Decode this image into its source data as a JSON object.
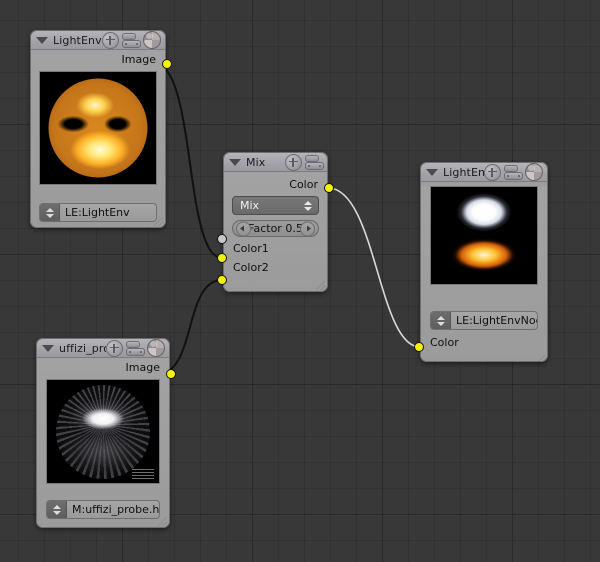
{
  "editor": {
    "name": "node-editor-canvas",
    "background_color": "#383838",
    "grid_color": "#2e2e2e"
  },
  "colors": {
    "socket_color": "#f2f20a",
    "socket_value": "#c8c8c8",
    "node_header": "#a3a3a9",
    "node_body": "#9b9b9b",
    "link_unselected": "#111111",
    "link_selected": "#d8d8d8"
  },
  "nodes": [
    {
      "id": "lightenv-source",
      "title": "LightEnv",
      "header_icons": [
        "plus-icon",
        "toggle-icon",
        "sphere-preview-icon"
      ],
      "outputs": [
        {
          "label": "Image",
          "type": "color"
        }
      ],
      "inputs": [],
      "field": {
        "label": "LE:LightEnv",
        "widget": "stepper-text"
      },
      "preview": "orange-light-probe"
    },
    {
      "id": "mix",
      "title": "Mix",
      "header_icons": [
        "plus-icon",
        "toggle-icon"
      ],
      "outputs": [
        {
          "label": "Color",
          "type": "color"
        }
      ],
      "dropdown": {
        "value": "Mix"
      },
      "slider": {
        "label": "Factor 0.5",
        "name": "Factor",
        "value": "0.5"
      },
      "inputs": [
        {
          "label": "Color1",
          "type": "color"
        },
        {
          "label": "Color2",
          "type": "color"
        }
      ]
    },
    {
      "id": "uffizi-probe",
      "title": "uffizi_pro",
      "header_icons": [
        "plus-icon",
        "toggle-icon",
        "sphere-preview-icon"
      ],
      "outputs": [
        {
          "label": "Image",
          "type": "color"
        }
      ],
      "inputs": [],
      "field": {
        "label": "M:uffizi_probe.h",
        "widget": "stepper-text"
      },
      "preview": "uffizi-environment-probe"
    },
    {
      "id": "lightenv-output",
      "title": "LightEnv",
      "header_icons": [
        "plus-icon",
        "toggle-icon",
        "sphere-preview-icon"
      ],
      "outputs": [],
      "field": {
        "label": "LE:LightEnvNode",
        "widget": "stepper-text"
      },
      "inputs": [
        {
          "label": "Color",
          "type": "color"
        }
      ],
      "preview": "blue-orange-light-probe"
    }
  ],
  "links": [
    {
      "from": "lightenv-source.Image",
      "to": "mix.Color1",
      "selected": false
    },
    {
      "from": "uffizi-probe.Image",
      "to": "mix.Color2",
      "selected": false
    },
    {
      "from": "mix.Color",
      "to": "lightenv-output.Color",
      "selected": true
    }
  ]
}
